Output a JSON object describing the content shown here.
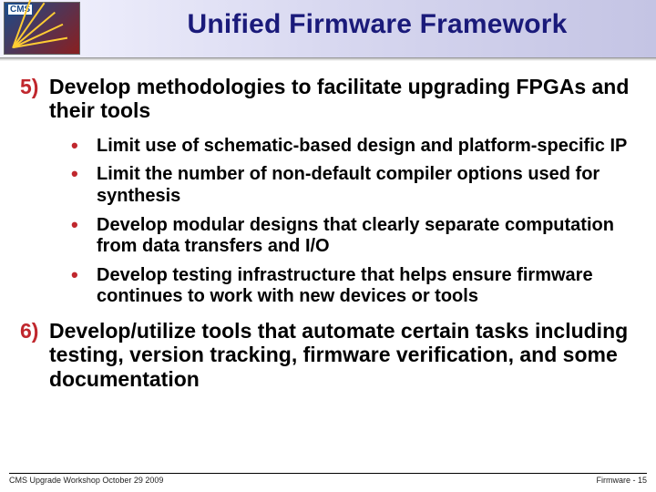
{
  "logo": {
    "label": "CMS"
  },
  "title": "Unified Firmware Framework",
  "items": [
    {
      "marker": "5)",
      "text": "Develop methodologies to facilitate upgrading FPGAs and their tools"
    },
    {
      "marker": "6)",
      "text": "Develop/utilize tools that automate certain tasks including testing, version tracking, firmware verification, and some documentation"
    }
  ],
  "bullets": [
    "Limit use of schematic-based design and platform-specific IP",
    "Limit the number of non-default compiler options used for synthesis",
    "Develop modular designs that clearly separate computation from data transfers and I/O",
    "Develop testing infrastructure that helps ensure firmware continues to work with new devices or tools"
  ],
  "footer": {
    "left": "CMS Upgrade Workshop October 29 2009",
    "right_label": "Firmware -",
    "right_page": "15"
  }
}
